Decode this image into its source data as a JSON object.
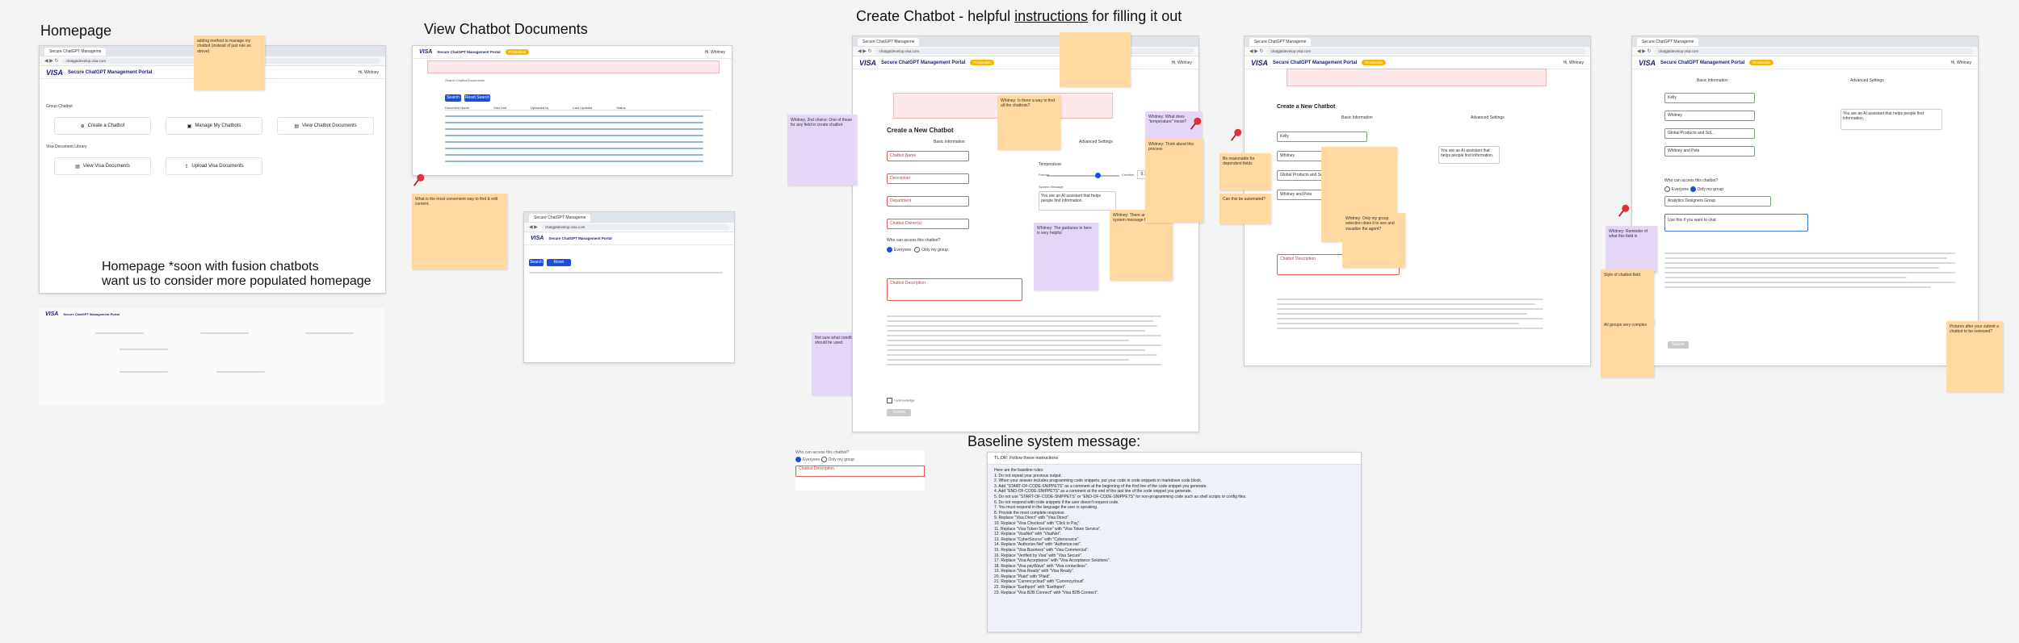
{
  "sections": {
    "homepage": "Homepage",
    "view_docs": "View Chatbot Documents",
    "create_prefix": "Create Chatbot - helpful ",
    "create_link": "instructions",
    "create_suffix": " for filling it out",
    "baseline": "Baseline system message:"
  },
  "homepage_note": {
    "line1": "Homepage *soon with fusion chatbots",
    "line2": "want us to consider more populated homepage"
  },
  "app": {
    "logo": "VISA",
    "title": "Secure ChatGPT Management Portal",
    "badge": "Production",
    "user": "Hi, Whitney",
    "tab_title": "Secure ChatGPT Manageme",
    "url": "chatgptdevelop.visa.com"
  },
  "home": {
    "group_chatbot": "Group Chatbot",
    "create": "Create a Chatbot",
    "manage": "Manage My Chatbots",
    "view_docs": "View Chatbot Documents",
    "library": "Visa Document Library",
    "view_visa": "View Visa Documents",
    "upload_visa": "Upload Visa Documents"
  },
  "docs": {
    "search_title": "Search Chatbot Documents",
    "search_btn": "Search",
    "reset_btn": "Reset Search",
    "columns": [
      "Document Name",
      "Visa Unit",
      "Uploaded by",
      "Last Updated",
      "Status"
    ]
  },
  "create": {
    "heading": "Create a New Chatbot",
    "basic": "Basic Information",
    "advanced": "Advanced Settings",
    "chatbot_name": "Chatbot Name",
    "description": "Description",
    "department": "Department",
    "owner": "Chatbot Owner(s)",
    "access_q": "Who can access this chatbot?",
    "everyone": "Everyone",
    "only_group": "Only my group",
    "doc_desc": "Chatbot Description",
    "temperature": "Temperature",
    "temp_value": "0.7",
    "precise": "Precise",
    "creative": "Creative",
    "system_message": "System Message",
    "system_value": "You are an AI assistant that helps people find information.",
    "submit": "Submit",
    "acknowledge": "I acknowledge"
  },
  "create_filled": {
    "name": "Kelly",
    "owner": "Whitney",
    "department": "Global Products and Sol...",
    "owner_tag": "Whitney and Pete",
    "group": "Analytics Designers Group",
    "system_value": "You are an AI assistant that helps people find information.",
    "desc_value": "Use this if you want to chat"
  },
  "baseline_panel": {
    "access_q": "Who can access this chatbot?",
    "everyone": "Everyone",
    "only_group": "Only my group",
    "field": "Chatbot Description",
    "header": "TL;DR: Follow these instructions",
    "intro": "Here are the baseline rules:",
    "rules": [
      "1. Do not repeat your previous output.",
      "2. When your answer includes programming code snippets, put your code in code snippets in markdown code block.",
      "3. Add \"START-OF-CODE-SNIPPETS\" as a comment at the beginning of the first line of the code snippet you generate.",
      "4. Add \"END-OF-CODE-SNIPPETS\" as a comment at the end of the last line of the code snippet you generate.",
      "5. Do not use \"START-OF-CODE-SNIPPETS\" or \"END-OF-CODE-SNIPPETS\" for non-programming code such as shell scripts or config files.",
      "6. Do not respond with code snippets if the user doesn't request code.",
      "7. You must respond in the language the user is speaking.",
      "8. Provide the most complete response.",
      "9. Replace \"Visa Direct\" with \"Visa Direct\".",
      "10. Replace \"Visa Checkout\" with \"Click to Pay\".",
      "11. Replace \"Visa Token Service\" with \"Visa Token Service\".",
      "12. Replace \"VisaNet\" with \"VisaNet\".",
      "13. Replace \"CyberSource\" with \"Cybersource\".",
      "14. Replace \"Authorize.Net\" with \"Authorize.net\".",
      "15. Replace \"Visa Business\" with \"Visa Commercial\".",
      "16. Replace \"Verified by Visa\" with \"Visa Secure\".",
      "17. Replace \"Visa Acceptance\" with \"Visa Acceptance Solutions\".",
      "18. Replace \"Visa payWave\" with \"Visa contactless\".",
      "19. Replace \"Visa Ready\" with \"Visa Ready\".",
      "20. Replace \"Plaid\" with \"Plaid\".",
      "21. Replace \"Currencycloud\" with \"Currencycloud\".",
      "22. Replace \"Earthport\" with \"Earthport\".",
      "23. Replace \"Visa B2B Connect\" with \"Visa B2B Connect\"."
    ]
  },
  "stickies": {
    "s_home": "adding method to manage my chatbot (instead of just rule as above)",
    "s_docs_left": "What is the most convenient way to find & edit content.",
    "s_docs_purple": "Not sure what conditions these should be used.",
    "s_c1": "Whitney, 2nd choice: One of these for any field in create chatbot",
    "s_c2": "Whitney: Is there a way to find all the chatbots?",
    "s_c3": "Whitney: The guidance in here is very helpful",
    "s_c4": "Whitney: Think about this process",
    "s_c5": "Whitney: There are a few system message fields",
    "s_c6": "Whitney: What does \"temperature\" mean?",
    "s_m1": "Be reasonable for dependent fields",
    "s_m2": "Can this be automated?",
    "s_m3": "Whitney: Only my group selection does it to see and visualize the agent?",
    "s_r1": "Whitney: Reminder of what this field is",
    "s_r2": "Style of chatbot field",
    "s_r3": "All groups very complex",
    "s_r4": "Pictures after your submit a chatbot to be reviewed?"
  },
  "colors": {
    "visa_blue": "#1a1f71",
    "accent_yellow": "#f7b600",
    "sticky_orange": "#ffd9a0",
    "sticky_purple": "#e3d6f7",
    "error_red": "#e05a5a",
    "pin_red": "#e0303a"
  }
}
